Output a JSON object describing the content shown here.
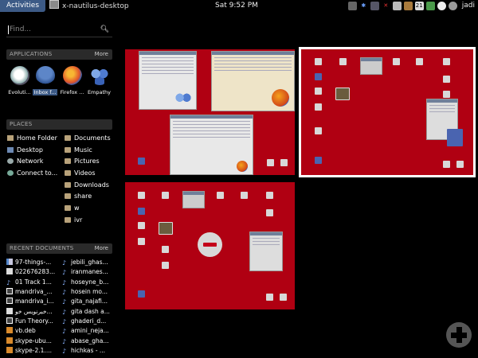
{
  "topbar": {
    "activities": "Activities",
    "app_menu": "x-nautilus-desktop",
    "clock": "Sat   9:52 PM",
    "user": "jadi",
    "tray_icons": [
      "monitor-icon",
      "bluetooth-icon",
      "network-icon",
      "volume-icon",
      "battery-icon",
      "update-icon",
      "calendar-icon",
      "pidgin-icon",
      "empathy-icon",
      "user-status-icon"
    ]
  },
  "search": {
    "placeholder": "Find..."
  },
  "applications": {
    "title": "APPLICATIONS",
    "more": "More",
    "items": [
      {
        "label": "Evoluti...",
        "icon": "evolution-icon"
      },
      {
        "label": "Inbox f...",
        "icon": "thunderbird-icon"
      },
      {
        "label": "Firefox ...",
        "icon": "firefox-icon"
      },
      {
        "label": "Empathy",
        "icon": "empathy-icon"
      }
    ]
  },
  "places": {
    "title": "PLACES",
    "left": [
      {
        "label": "Home Folder",
        "icon": "home-folder-icon"
      },
      {
        "label": "Desktop",
        "icon": "desktop-icon"
      },
      {
        "label": "Network",
        "icon": "network-icon"
      },
      {
        "label": "Connect to...",
        "icon": "connect-icon"
      }
    ],
    "right": [
      {
        "label": "Documents",
        "icon": "folder-icon"
      },
      {
        "label": "Music",
        "icon": "folder-icon"
      },
      {
        "label": "Pictures",
        "icon": "folder-icon"
      },
      {
        "label": "Videos",
        "icon": "folder-icon"
      },
      {
        "label": "Downloads",
        "icon": "folder-icon"
      },
      {
        "label": "share",
        "icon": "folder-icon"
      },
      {
        "label": "w",
        "icon": "folder-icon"
      },
      {
        "label": "ivr",
        "icon": "folder-icon"
      }
    ]
  },
  "recent": {
    "title": "RECENT DOCUMENTS",
    "more": "More",
    "left": [
      {
        "label": "97-things-...",
        "icon": "pdf-icon"
      },
      {
        "label": "022676283...",
        "icon": "text-icon"
      },
      {
        "label": "01 Track 1...",
        "icon": "music-icon"
      },
      {
        "label": "mandriva_...",
        "icon": "image-icon"
      },
      {
        "label": "mandriva_i...",
        "icon": "image-icon"
      },
      {
        "label": "خبرنویس خو...",
        "icon": "text-icon"
      },
      {
        "label": "Fun Theory...",
        "icon": "image-icon"
      },
      {
        "label": "vb.deb",
        "icon": "package-icon"
      },
      {
        "label": "skype-ubu...",
        "icon": "package-icon"
      },
      {
        "label": "skype-2.1....",
        "icon": "package-icon"
      }
    ],
    "right": [
      {
        "label": "jebili_ghas...",
        "icon": "music-icon"
      },
      {
        "label": "iranmanes...",
        "icon": "music-icon"
      },
      {
        "label": "hoseyne_b...",
        "icon": "music-icon"
      },
      {
        "label": "hosein mo...",
        "icon": "music-icon"
      },
      {
        "label": "gita_najafi...",
        "icon": "music-icon"
      },
      {
        "label": "gita dash a...",
        "icon": "music-icon"
      },
      {
        "label": "ghaderi_d...",
        "icon": "music-icon"
      },
      {
        "label": "amini_neja...",
        "icon": "music-icon"
      },
      {
        "label": "abase_gha...",
        "icon": "music-icon"
      },
      {
        "label": "hichkas - ...",
        "icon": "music-icon"
      }
    ]
  },
  "workspaces": {
    "count": 3,
    "active_index": 1,
    "remove_icon": "remove-workspace-icon",
    "add_icon": "add-workspace-icon"
  },
  "colors": {
    "accent": "#3c5a86",
    "workspace_bg": "#b00012"
  }
}
